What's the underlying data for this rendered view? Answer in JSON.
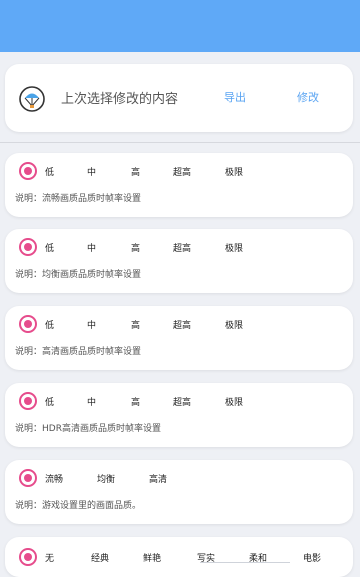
{
  "header": {
    "title": "上次选择修改的内容",
    "export_label": "导出",
    "modify_label": "修改",
    "icon": "parachute-icon"
  },
  "colors": {
    "topbar": "#5fa9f7",
    "accent_pink": "#e64c8c",
    "link_blue": "#5aa4f2",
    "background": "#eef0f5"
  },
  "settings": [
    {
      "options": [
        "低",
        "中",
        "高",
        "超高",
        "极限"
      ],
      "description": "说明：流畅画质品质时帧率设置"
    },
    {
      "options": [
        "低",
        "中",
        "高",
        "超高",
        "极限"
      ],
      "description": "说明：均衡画质品质时帧率设置"
    },
    {
      "options": [
        "低",
        "中",
        "高",
        "超高",
        "极限"
      ],
      "description": "说明：高清画质品质时帧率设置"
    },
    {
      "options": [
        "低",
        "中",
        "高",
        "超高",
        "极限"
      ],
      "description": "说明：HDR高清画质品质时帧率设置"
    },
    {
      "options": [
        "流畅",
        "均衡",
        "高清"
      ],
      "description": "说明：游戏设置里的画面品质。"
    },
    {
      "options": [
        "无",
        "经典",
        "鲜艳",
        "写实",
        "柔和",
        "电影"
      ],
      "description": ""
    }
  ]
}
